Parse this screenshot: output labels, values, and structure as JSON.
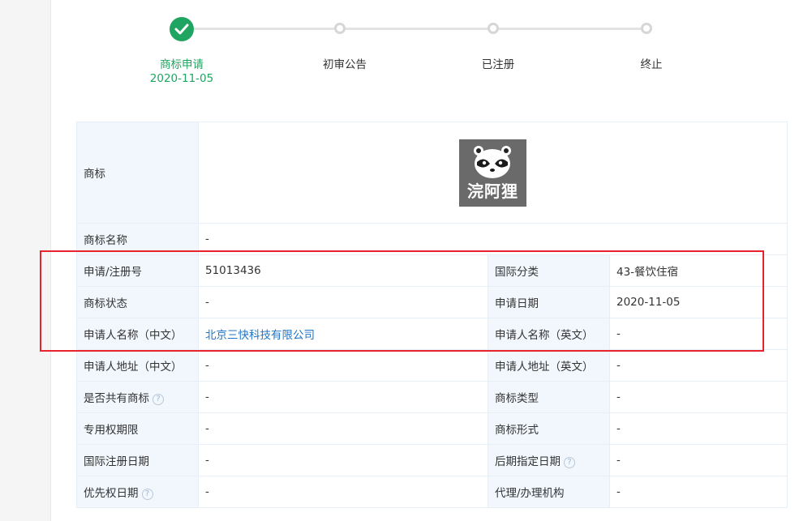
{
  "steps": [
    {
      "label": "商标申请",
      "date": "2020-11-05",
      "state": "done"
    },
    {
      "label": "初审公告",
      "state": "pending"
    },
    {
      "label": "已注册",
      "state": "pending"
    },
    {
      "label": "终止",
      "state": "pending"
    }
  ],
  "logo": {
    "text": "浣阿狸"
  },
  "rows": {
    "trademark": {
      "k": "商标"
    },
    "name": {
      "k": "商标名称",
      "v": "-"
    },
    "reg_no": {
      "k": "申请/注册号",
      "v": "51013436"
    },
    "intl_class": {
      "k": "国际分类",
      "v": "43-餐饮住宿"
    },
    "status": {
      "k": "商标状态",
      "v": "-"
    },
    "apply_date": {
      "k": "申请日期",
      "v": "2020-11-05"
    },
    "applicant_cn": {
      "k": "申请人名称（中文）",
      "v": "北京三快科技有限公司"
    },
    "applicant_en": {
      "k": "申请人名称（英文）",
      "v": "-"
    },
    "address_cn": {
      "k": "申请人地址（中文）",
      "v": "-"
    },
    "address_en": {
      "k": "申请人地址（英文）",
      "v": "-"
    },
    "shared": {
      "k": "是否共有商标",
      "v": "-"
    },
    "tm_type": {
      "k": "商标类型",
      "v": "-"
    },
    "exclusive_period": {
      "k": "专用权期限",
      "v": "-"
    },
    "tm_form": {
      "k": "商标形式",
      "v": "-"
    },
    "intl_reg_date": {
      "k": "国际注册日期",
      "v": "-"
    },
    "later_designation": {
      "k": "后期指定日期",
      "v": "-"
    },
    "priority_date": {
      "k": "优先权日期",
      "v": "-"
    },
    "agent": {
      "k": "代理/办理机构",
      "v": "-"
    }
  },
  "help_icon_glyph": "?",
  "colors": {
    "accent_green": "#1fa561",
    "link_blue": "#1f74c7",
    "highlight_red": "#e8232b"
  }
}
